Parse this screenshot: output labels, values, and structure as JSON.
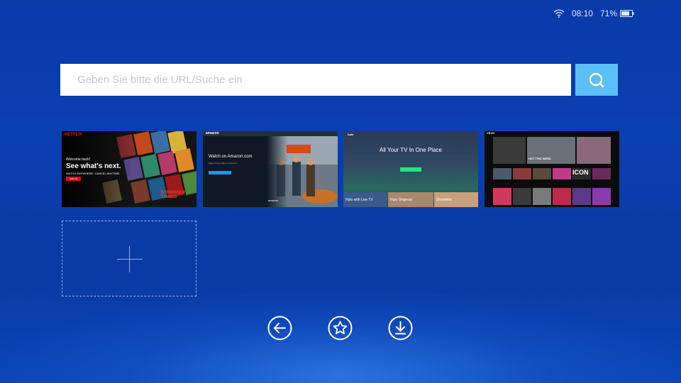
{
  "status_bar": {
    "time": "08:10",
    "battery": "71%",
    "wifi_icon": "wifi-icon",
    "battery_icon": "battery-icon"
  },
  "search": {
    "placeholder": "Geben Sie bitte die URL/Suche ein",
    "value": "",
    "button_icon": "search-icon"
  },
  "thumbnails": [
    {
      "name": "netflix",
      "logo": "NETFLIX",
      "lines": [
        "Welcome back!",
        "See what's next.",
        "WATCH ANYWHERE. CANCEL ANYTIME.",
        "SIGN IN"
      ],
      "tiles": [
        "STRANGER THINGS"
      ],
      "accent": "#e50914"
    },
    {
      "name": "amazon",
      "logo": "amazon",
      "lines": [
        "Watch on Amazon.com",
        "Enjoy Prime Video on Amazon"
      ],
      "tiles": [
        "amazon"
      ],
      "accent": "#1a98ff"
    },
    {
      "name": "hulu",
      "logo": "hulu",
      "lines": [
        "All Your TV In One Place",
        "START YOUR FREE TRIAL"
      ],
      "tiles": [
        "Hulu with Live TV",
        "Hulu Originals",
        "Showtime"
      ],
      "accent": "#1ce783"
    },
    {
      "name": "vevo",
      "logo": "VEVO",
      "lines": [
        "HOT THIS WEEK"
      ],
      "tiles": [
        "ICON"
      ],
      "accent": "#ffffff"
    }
  ],
  "add_tile": {
    "icon": "plus-icon"
  },
  "bottom_nav": [
    {
      "name": "back",
      "icon": "arrow-left-icon"
    },
    {
      "name": "favorites",
      "icon": "star-icon"
    },
    {
      "name": "downloads",
      "icon": "download-icon"
    }
  ],
  "colors": {
    "background": "#0a3fb2",
    "search_button": "#5bc0f8",
    "placeholder": "#c5c8cf"
  }
}
